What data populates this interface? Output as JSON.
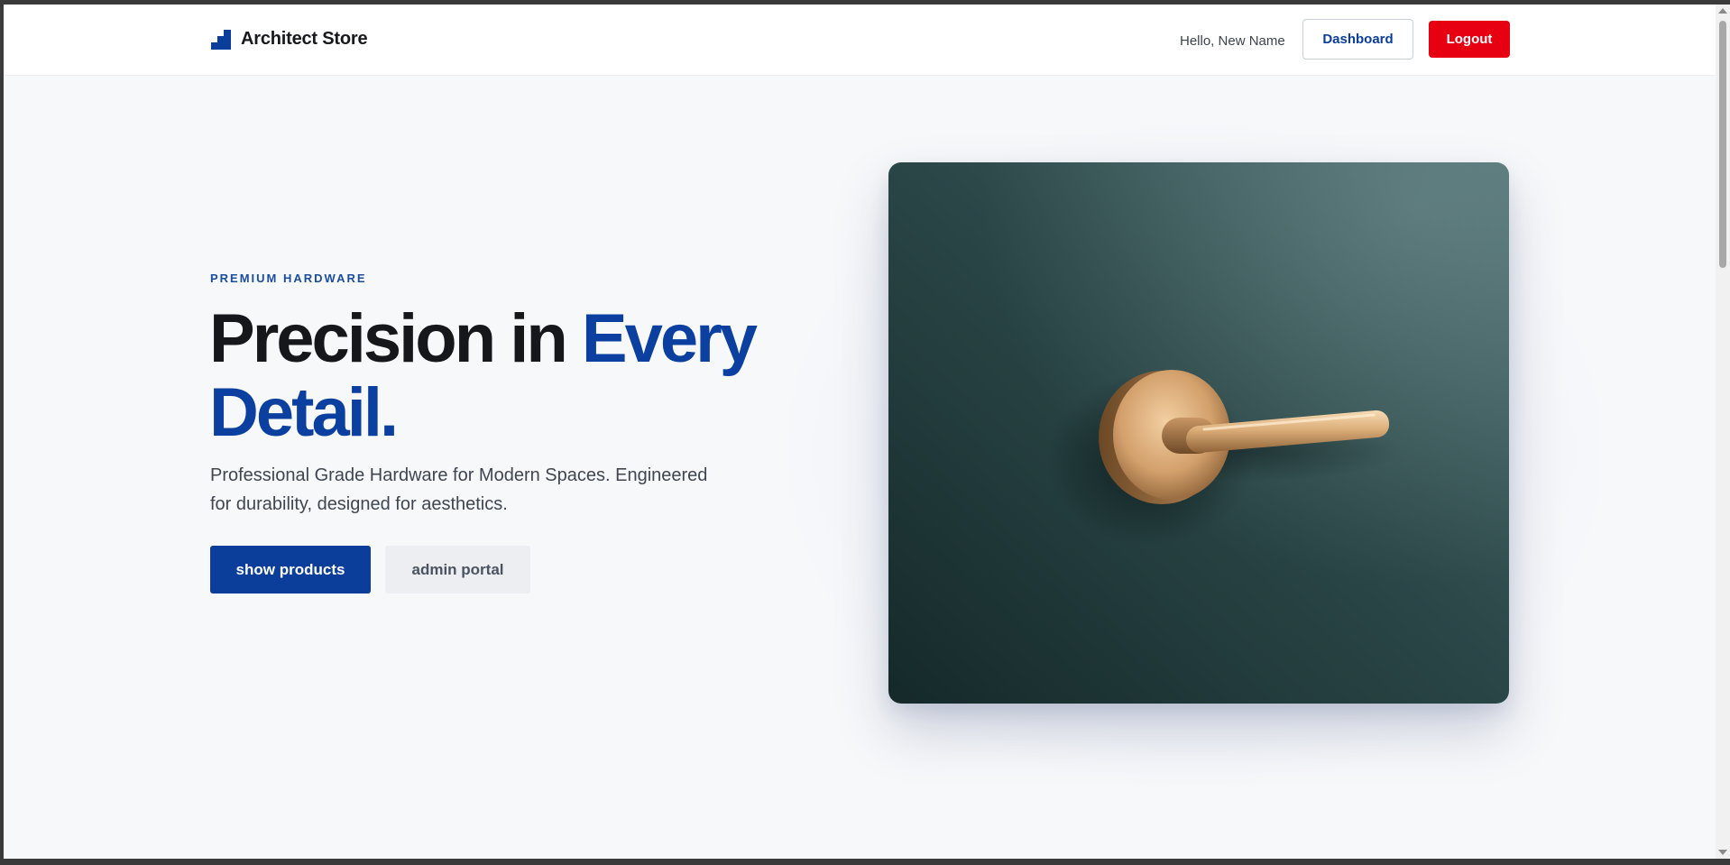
{
  "header": {
    "brand_name": "Architect Store",
    "greeting": "Hello, New Name",
    "dashboard_label": "Dashboard",
    "logout_label": "Logout"
  },
  "hero": {
    "eyebrow": "PREMIUM HARDWARE",
    "headline_plain": "Precision in ",
    "headline_accent": "Every Detail.",
    "subtitle": "Professional Grade Hardware for Modern Spaces. Engineered for durability, designed for aesthetics.",
    "primary_button": "show products",
    "secondary_button": "admin portal",
    "image_subject": "brass door lever handle on dark green wall"
  },
  "icons": {
    "brand": "stair-steps-logo-icon",
    "scroll_up": "chevron-up-icon",
    "scroll_down": "chevron-down-icon"
  },
  "colors": {
    "brand_blue": "#0a3e9a",
    "accent_blue": "#0b3fa0",
    "logout_red": "#e60012",
    "page_bg": "#f7f8fa",
    "wall_green": "#2c4a4a",
    "brass": "#c99a63"
  }
}
